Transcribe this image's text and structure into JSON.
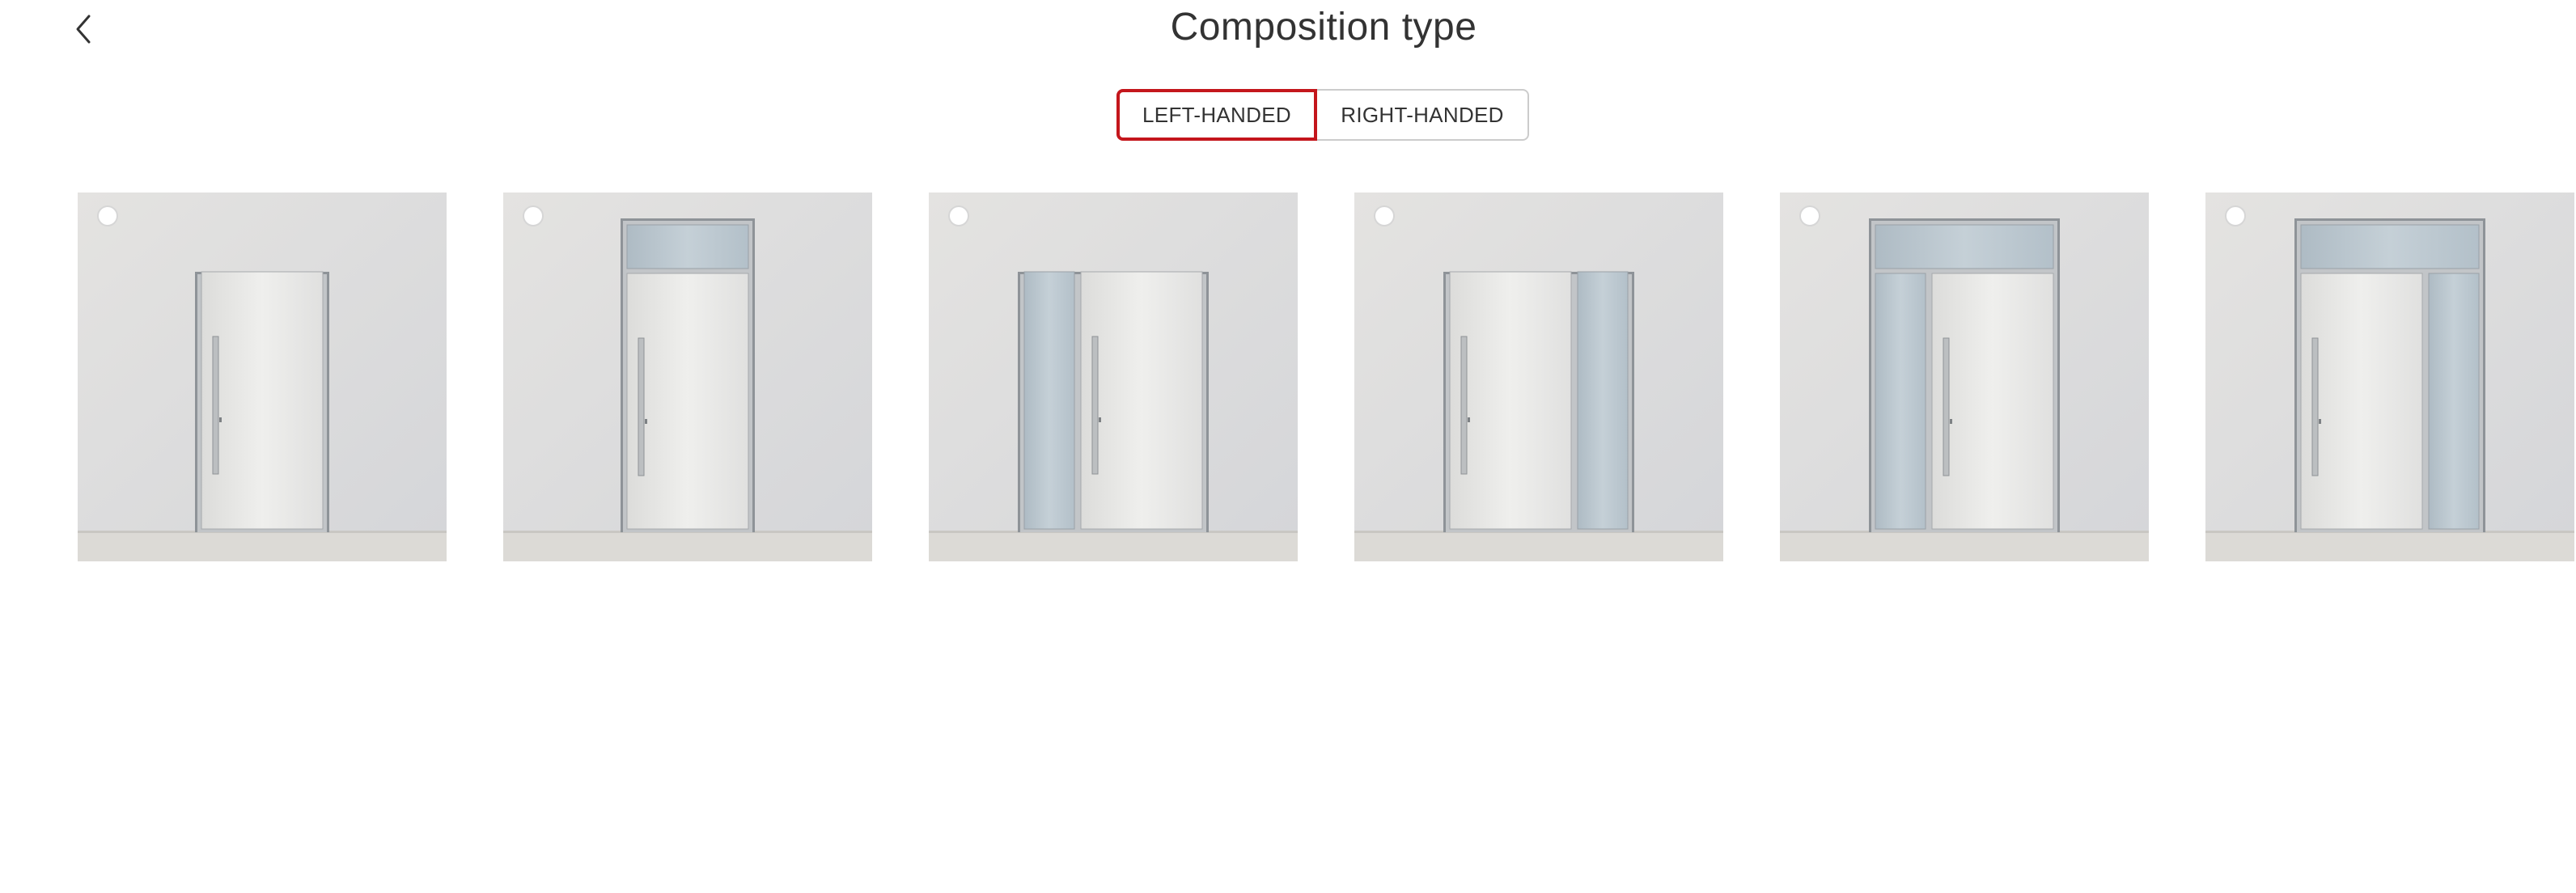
{
  "header": {
    "title": "Composition type",
    "back_icon": "chevron-left-icon"
  },
  "handedness": {
    "options": [
      {
        "label": "LEFT-HANDED",
        "selected": true
      },
      {
        "label": "RIGHT-HANDED",
        "selected": false
      }
    ],
    "accent_color": "#c4161c"
  },
  "compositions": [
    {
      "id": "door-only",
      "transom": false,
      "sidelight_left": false,
      "sidelight_right": false,
      "selected": false
    },
    {
      "id": "door-transom",
      "transom": true,
      "sidelight_left": false,
      "sidelight_right": false,
      "selected": false
    },
    {
      "id": "door-sidelight-left",
      "transom": false,
      "sidelight_left": true,
      "sidelight_right": false,
      "selected": false
    },
    {
      "id": "door-sidelight-right",
      "transom": false,
      "sidelight_left": false,
      "sidelight_right": true,
      "selected": false
    },
    {
      "id": "door-transom-sidelight-left",
      "transom": true,
      "sidelight_left": true,
      "sidelight_right": false,
      "selected": false
    },
    {
      "id": "door-transom-sidelight-right",
      "transom": true,
      "sidelight_left": false,
      "sidelight_right": true,
      "selected": false
    }
  ]
}
